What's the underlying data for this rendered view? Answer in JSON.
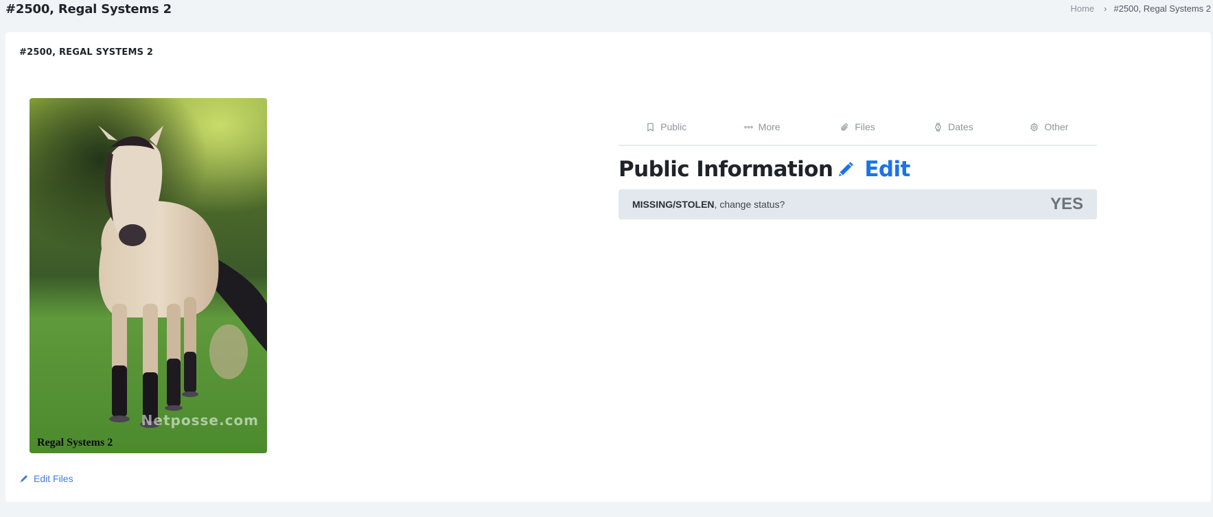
{
  "page": {
    "title": "#2500, Regal Systems 2"
  },
  "breadcrumb": {
    "home": "Home",
    "separator": "›",
    "current": "#2500, Regal Systems 2"
  },
  "card": {
    "title": "#2500, REGAL SYSTEMS 2",
    "photo": {
      "alt": "Buckskin horse standing in a green pasture",
      "caption": "Regal Systems 2",
      "watermark": "Netposse.com"
    },
    "edit_files": {
      "icon": "pencil-icon",
      "label": "Edit Files"
    }
  },
  "tabs": [
    {
      "label": "Public",
      "icon": "bookmark-icon"
    },
    {
      "label": "More",
      "icon": "more-dots-icon"
    },
    {
      "label": "Files",
      "icon": "paperclip-icon"
    },
    {
      "label": "Dates",
      "icon": "watch-icon"
    },
    {
      "label": "Other",
      "icon": "gear-icon"
    }
  ],
  "section": {
    "heading": "Public Information",
    "edit_icon": "pencil-icon",
    "edit_label": "Edit",
    "status": {
      "status_label": "MISSING/STOLEN",
      "prompt": ", change status?",
      "action": "YES"
    }
  },
  "colors": {
    "accent": "#1a73e8",
    "link": "#3b7ddd",
    "background": "#f1f4f7",
    "status_bar": "#e3e8ee"
  }
}
